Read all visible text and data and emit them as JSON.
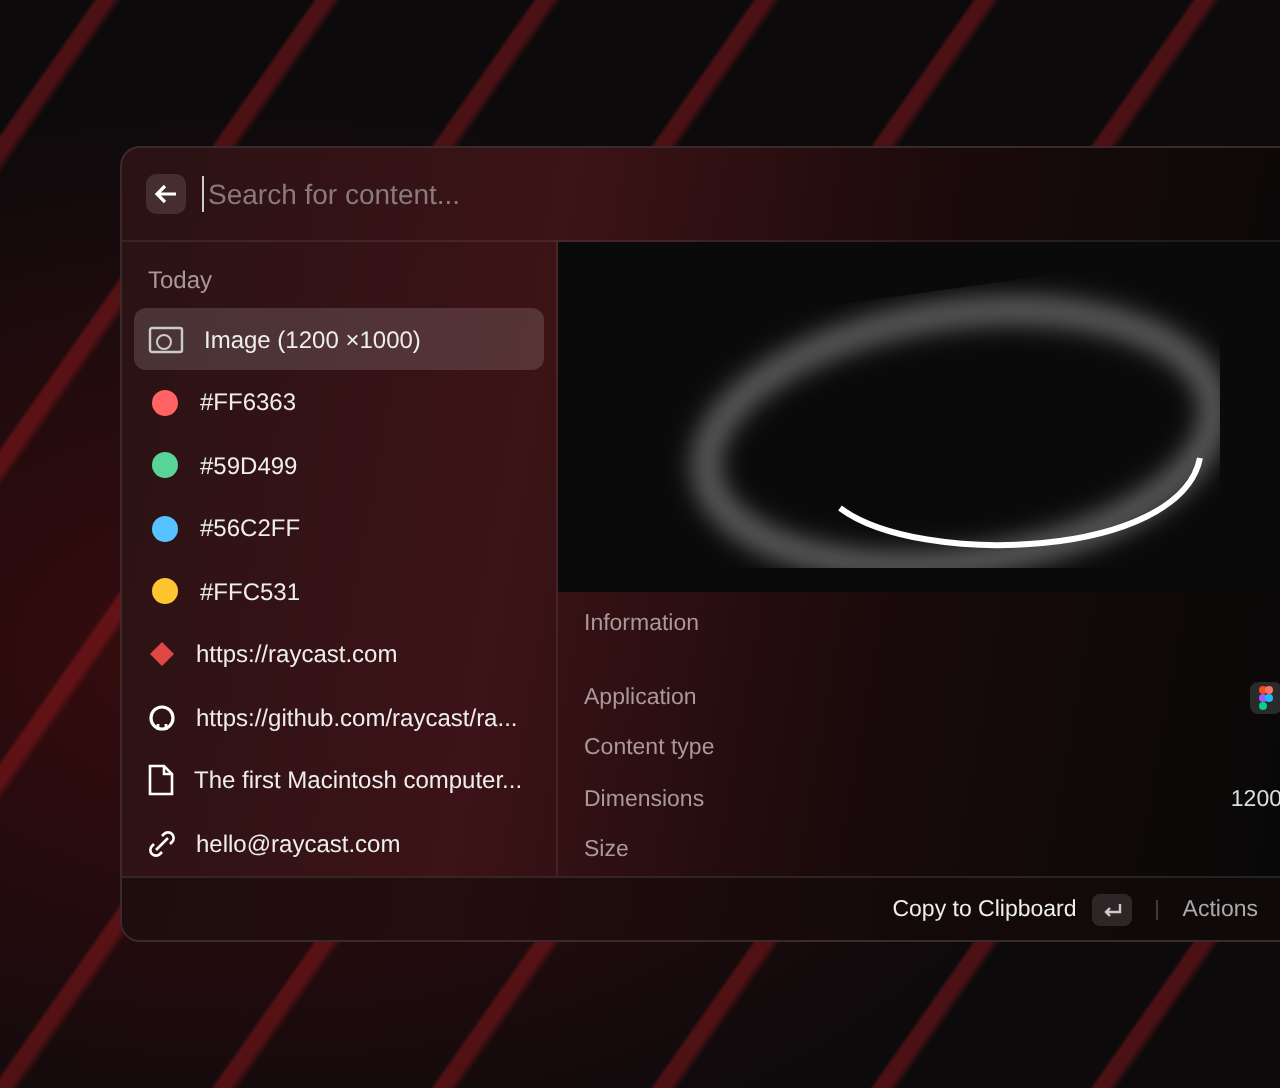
{
  "search": {
    "placeholder": "Search for content..."
  },
  "list": {
    "section": "Today",
    "items": [
      {
        "kind": "image",
        "label": "Image (1200 ×1000)",
        "selected": true
      },
      {
        "kind": "color",
        "label": "#FF6363",
        "color": "#ff6363",
        "selected": false
      },
      {
        "kind": "color",
        "label": "#59D499",
        "color": "#59d499",
        "selected": false
      },
      {
        "kind": "color",
        "label": "#56C2FF",
        "color": "#56c2ff",
        "selected": false
      },
      {
        "kind": "color",
        "label": "#FFC531",
        "color": "#ffc531",
        "selected": false
      },
      {
        "kind": "web",
        "label": "https://raycast.com",
        "selected": false
      },
      {
        "kind": "github",
        "label": "https://github.com/raycast/ra...",
        "selected": false
      },
      {
        "kind": "file",
        "label": "The first Macintosh computer...",
        "selected": false
      },
      {
        "kind": "link",
        "label": "hello@raycast.com",
        "selected": false
      }
    ]
  },
  "information": {
    "title": "Information",
    "rows": [
      {
        "label": "Application",
        "kind": "app-icon"
      },
      {
        "label": "Content type"
      },
      {
        "label": "Dimensions",
        "value": "1200"
      },
      {
        "label": "Size"
      }
    ]
  },
  "footer": {
    "primary_action": "Copy to Clipboard",
    "actions": "Actions"
  }
}
